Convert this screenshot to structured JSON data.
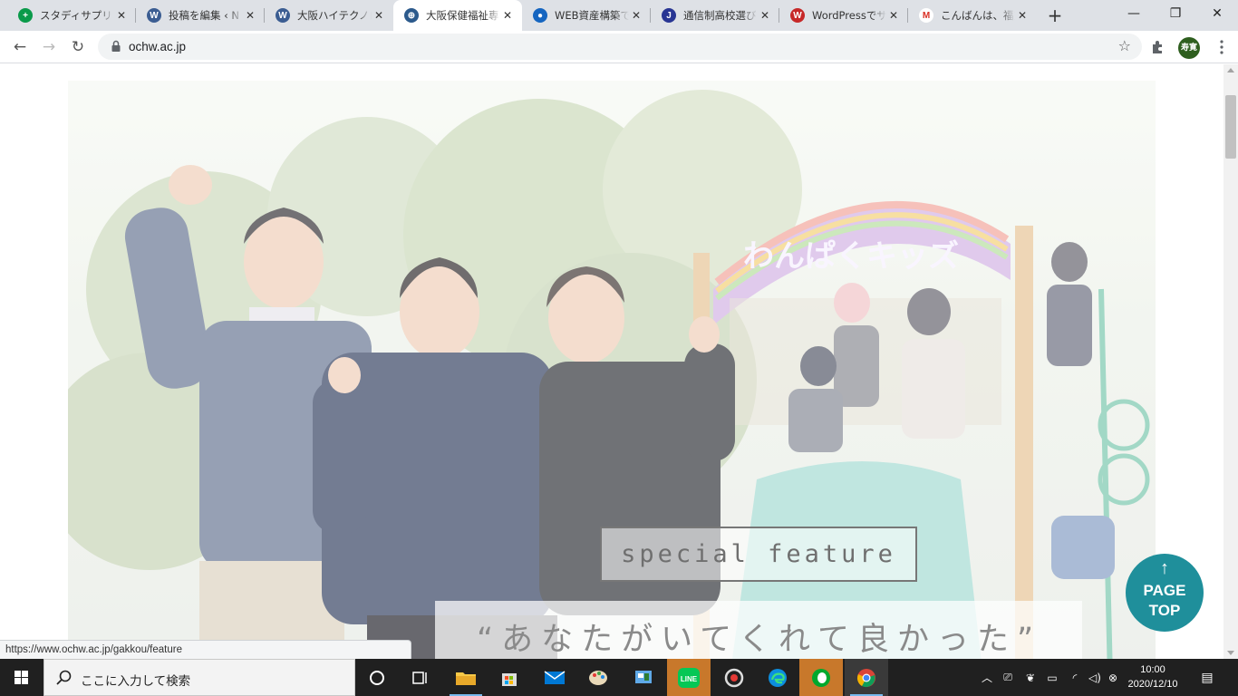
{
  "browser": {
    "tabs": [
      {
        "title": "スタディサプリ",
        "fav_color": "#0a9a4a",
        "fav_glyph": "+"
      },
      {
        "title": "投稿を編集 ‹ N",
        "fav_color": "#3b5d92",
        "fav_glyph": "W"
      },
      {
        "title": "大阪ハイテクノロ",
        "fav_color": "#3b5d92",
        "fav_glyph": "W"
      },
      {
        "title": "大阪保健福祉専",
        "fav_color": "#2c5a8c",
        "fav_glyph": "⊕",
        "active": true
      },
      {
        "title": "WEB資産構築で",
        "fav_color": "#1565c0",
        "fav_glyph": "●"
      },
      {
        "title": "通信制高校選び",
        "fav_color": "#283593",
        "fav_glyph": "J"
      },
      {
        "title": "WordPressでサ",
        "fav_color": "#c62828",
        "fav_glyph": "W"
      },
      {
        "title": "こんばんは、福重",
        "fav_color": "#ffffff",
        "fav_glyph": "M"
      }
    ],
    "url": "ochw.ac.jp",
    "profile_label": "寿寛",
    "status_url": "https://www.ochw.ac.jp/gakkou/feature"
  },
  "page": {
    "hero_sign": "わんぱくキッズ",
    "special_feature": "special feature",
    "quote": "“あなたがいてくれて良かった”",
    "pagetop": {
      "line1": "PAGE",
      "line2": "TOP"
    }
  },
  "taskbar": {
    "search_placeholder": "ここに入力して検索",
    "time": "10:00",
    "date": "2020/12/10"
  }
}
